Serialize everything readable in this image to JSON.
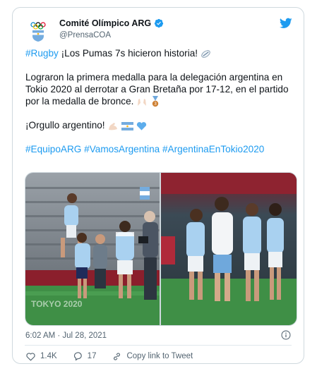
{
  "author": {
    "name": "Comité Olímpico ARG",
    "handle": "@PrensaCOA"
  },
  "tweet": {
    "line1_tag": "#Rugby",
    "line1_text": " ¡Los Pumas 7s hicieron historia!",
    "paragraph2": "Lograron la primera medalla para la delegación argentina en Tokio 2020 al derrotar a Gran Bretaña por 17-12, en el partido por la medalla de bronce.",
    "paragraph3": "¡Orgullo argentino!",
    "hashtags": [
      "#EquipoARG",
      "#VamosArgentina",
      "#ArgentinaEnTokio2020"
    ]
  },
  "media": {
    "left_alt": "Argentina rugby sevens players celebrating on the pitch",
    "right_alt": "Argentina players embracing after bronze medal win"
  },
  "meta": {
    "timestamp": "6:02 AM · Jul 28, 2021"
  },
  "actions": {
    "likes": "1.4K",
    "replies": "17",
    "copy_link": "Copy link to Tweet"
  },
  "colors": {
    "accent": "#1d9bf0",
    "like_red": "#f91880",
    "text": "#0f1419",
    "muted": "#536471"
  }
}
